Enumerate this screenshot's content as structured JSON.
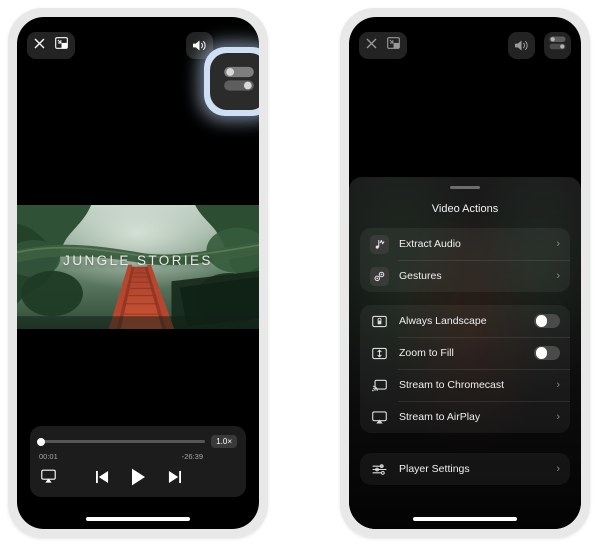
{
  "left_phone": {
    "topbar": {
      "close_icon": "close-icon",
      "pip_icon": "picture-in-picture-icon",
      "volume_icon": "speaker-volume-icon",
      "sliders_icon": "sliders-toggle-icon",
      "sliders_highlighted": true
    },
    "poster": {
      "title": "JUNGLE STORIES"
    },
    "player": {
      "filename": "Jungle Stories.mp4",
      "current_time": "00:01",
      "remaining_time": "-26:39",
      "speed": "1.0×",
      "progress_percent": 0,
      "airplay_icon": "airplay-icon",
      "previous_icon": "previous-track-icon",
      "play_icon": "play-icon",
      "next_icon": "next-track-icon"
    }
  },
  "right_phone": {
    "topbar": {
      "close_icon": "close-icon",
      "pip_icon": "picture-in-picture-icon",
      "volume_icon": "speaker-volume-icon",
      "sliders_icon": "sliders-toggle-icon"
    },
    "sheet": {
      "title": "Video Actions",
      "group_one": [
        {
          "label": "Extract Audio",
          "icon": "extract-audio-icon",
          "accessory": "chevron"
        },
        {
          "label": "Gestures",
          "icon": "gestures-icon",
          "accessory": "chevron"
        }
      ],
      "group_two": [
        {
          "label": "Always Landscape",
          "icon": "lock-landscape-icon",
          "accessory": "toggle",
          "toggle_on": false
        },
        {
          "label": "Zoom to Fill",
          "icon": "zoom-to-fill-icon",
          "accessory": "toggle",
          "toggle_on": false
        },
        {
          "label": "Stream to Chromecast",
          "icon": "chromecast-icon",
          "accessory": "chevron"
        },
        {
          "label": "Stream to AirPlay",
          "icon": "airplay-icon",
          "accessory": "chevron"
        }
      ],
      "group_three": [
        {
          "label": "Player Settings",
          "icon": "player-settings-icon",
          "accessory": "chevron"
        }
      ],
      "chevron_glyph": "›"
    }
  },
  "colors": {
    "page_background": "#ffffff",
    "phone_frame": "#e8e8e8",
    "screen_black": "#000000",
    "highlight_ring": "#cfe0f5",
    "sheet_background": "#1b1b1b",
    "toggle_off_track": "#4a4a4a"
  }
}
